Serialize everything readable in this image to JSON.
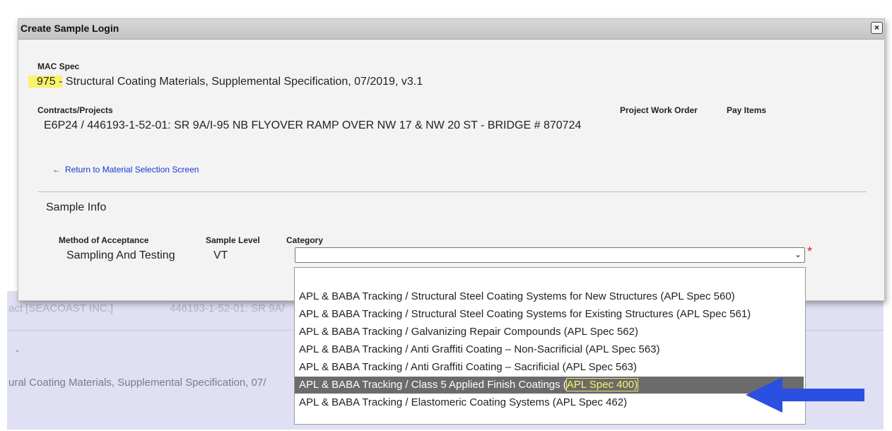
{
  "dialog": {
    "title": "Create Sample Login",
    "close_label": "×",
    "mac_spec_label": "MAC Spec",
    "mac_spec_number": "975 -",
    "mac_spec_rest": " Structural Coating Materials, Supplemental Specification, 07/2019, v3.1",
    "contracts_label": "Contracts/Projects",
    "contracts_value": "E6P24 / 446193-1-52-01: SR 9A/I-95 NB FLYOVER RAMP OVER NW 17 & NW 20 ST - BRIDGE # 870724",
    "project_work_order_label": "Project Work Order",
    "pay_items_label": "Pay Items",
    "return_link": "Return to Material Selection Screen",
    "return_arrow": "←",
    "sample_info_title": "Sample Info",
    "method_label": "Method of Acceptance",
    "method_value": "Sampling And Testing",
    "sample_level_label": "Sample Level",
    "sample_level_value": "VT",
    "category_label": "Category",
    "category_value": "",
    "chevron": "⌄",
    "required_mark": "*"
  },
  "dropdown": {
    "options": [
      {
        "label": "",
        "selected": false
      },
      {
        "label": "APL & BABA Tracking / Structural Steel Coating Systems for New Structures (APL Spec 560)",
        "selected": false
      },
      {
        "label": "APL & BABA Tracking / Structural Steel Coating Systems for Existing Structures (APL Spec 561)",
        "selected": false
      },
      {
        "label": "APL & BABA Tracking / Galvanizing Repair Compounds (APL Spec 562)",
        "selected": false
      },
      {
        "label": "APL & BABA Tracking / Anti Graffiti Coating – Non-Sacrificial (APL Spec 563)",
        "selected": false
      },
      {
        "label": "APL & BABA Tracking / Anti Graffiti Coating – Sacrificial (APL Spec 563)",
        "selected": false
      },
      {
        "label_prefix": "APL & BABA Tracking / Class 5 Applied Finish Coatings (",
        "label_highlight": "APL Spec 400)",
        "selected": true
      },
      {
        "label": "APL & BABA Tracking / Elastomeric Coating Systems (APL Spec 462)",
        "selected": false
      }
    ]
  },
  "background": {
    "contract_fragment": "act [SEACOAST INC.]",
    "project_fragment": "446193-1-52-01: SR 9A/",
    "spec_fragment": "ural Coating Materials, Supplemental Specification, 07/",
    "dash": "-"
  },
  "colors": {
    "highlight": "#f8f36a",
    "link": "#1a35d6",
    "selected_option": "#6b6b6b",
    "annotation_arrow": "#2b4fe0",
    "required": "#e02020"
  }
}
